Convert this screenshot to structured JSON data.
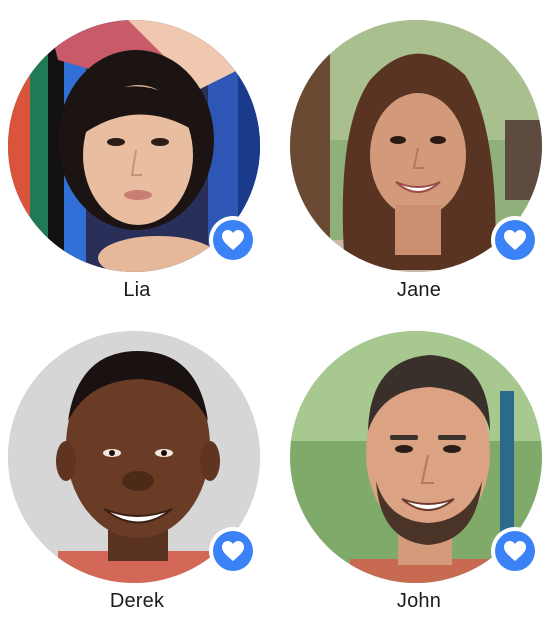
{
  "accent_color": "#3b82f6",
  "badge_icon": "heart-icon",
  "contacts": [
    {
      "name": "Lia"
    },
    {
      "name": "Jane"
    },
    {
      "name": "Derek"
    },
    {
      "name": "John"
    }
  ]
}
